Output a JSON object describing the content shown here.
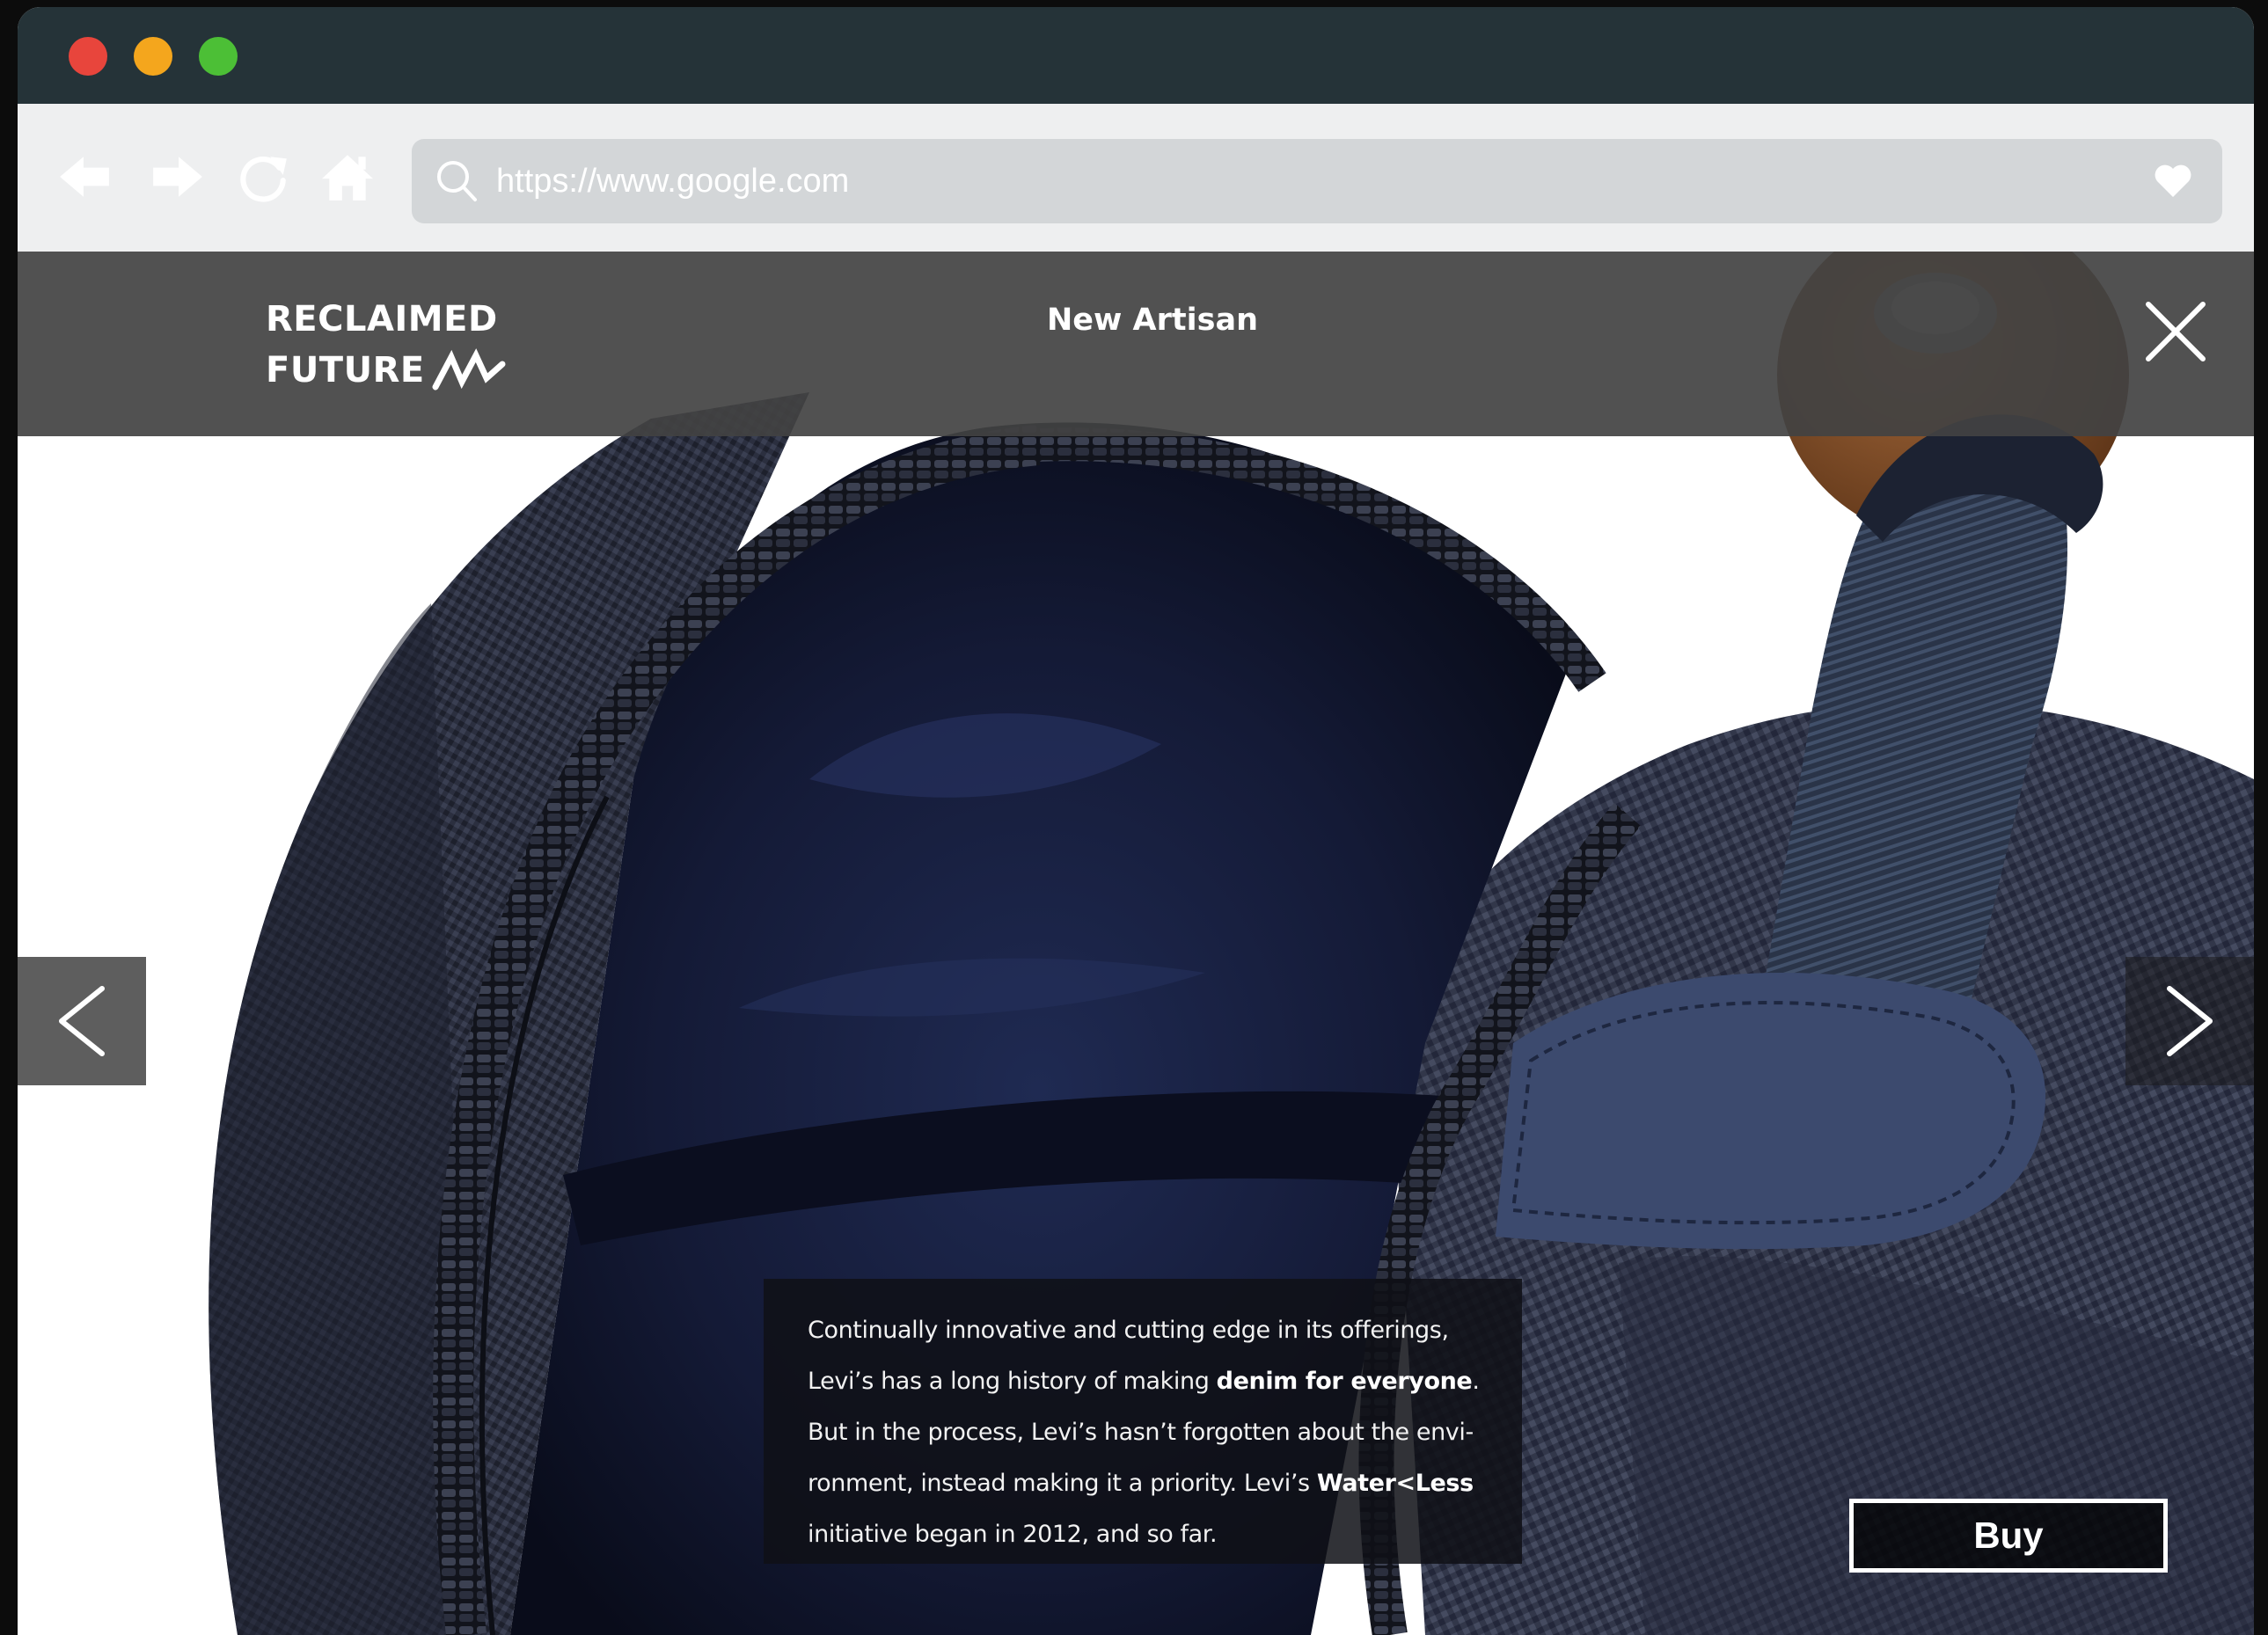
{
  "window": {
    "controls": [
      "close",
      "minimize",
      "zoom"
    ],
    "colors": {
      "close": "#e8453c",
      "minimize": "#f4a61d",
      "zoom": "#4cbf36",
      "titlebar": "#253338"
    }
  },
  "toolbar": {
    "icons": [
      "back-arrow-icon",
      "forward-arrow-icon",
      "reload-icon",
      "home-icon"
    ],
    "url_placeholder": "https://www.google.com",
    "search_icon": "search-icon",
    "favorite_icon": "heart-icon"
  },
  "header": {
    "logo_line1": "RECLAIMED",
    "logo_line2": "FUTURE",
    "title": "New Artisan",
    "close_icon": "close-icon"
  },
  "slideshow": {
    "prev_icon": "chevron-left-icon",
    "next_icon": "chevron-right-icon"
  },
  "description": {
    "line1": "Continually innovative and cutting edge in its offerings,",
    "line2_pre": "Levi’s has a long history of making ",
    "line2_bold": "denim for everyone",
    "line2_post": ".",
    "line3": "But in the process, Levi’s hasn’t forgotten about the envi-",
    "line4_pre": "ronment, instead making it a priority. Levi’s ",
    "line4_bold": "Water<Less",
    "line5": "initiative began in 2012, and so far."
  },
  "buy_button": {
    "label": "Buy"
  }
}
